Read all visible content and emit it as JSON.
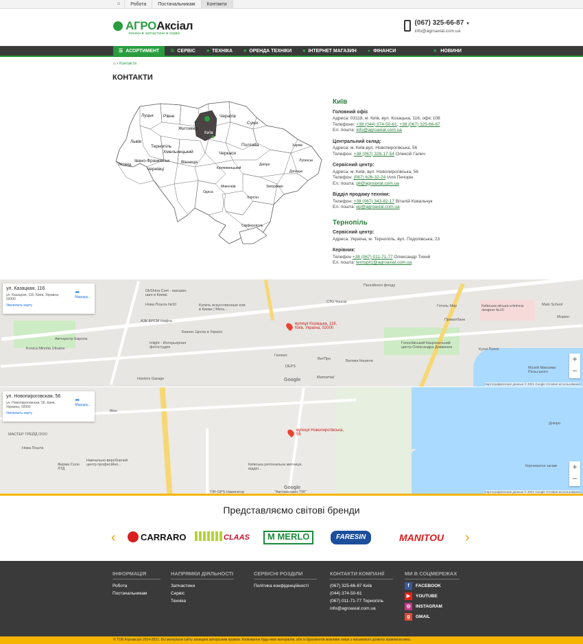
{
  "topbar": {
    "home_icon": "home-icon",
    "links": [
      "Робота",
      "Постачальникам",
      "Контакти"
    ]
  },
  "logo": {
    "part1": "АГРО",
    "part2": "Аксіал",
    "tagline": "техніка ● запчастини ● сервіс"
  },
  "contact_header": {
    "phone": "(067) 325-66-87",
    "email": "info@agroaxial.com.ua",
    "icon": "smartphone-icon"
  },
  "nav": {
    "items": [
      "АСОРТИМЕНТ",
      "СЕРВІС",
      "ТЕХНІКА",
      "ОРЕНДА ТЕХНІКИ",
      "ІНТЕРНЕТ МАГАЗИН",
      "ФІНАНСИ"
    ],
    "right": "НОВИНИ"
  },
  "breadcrumb": {
    "current": "Контакти"
  },
  "page_title": "КОНТАКТИ",
  "map_regions": [
    "Луцьк",
    "Рівне",
    "Житомир",
    "Київ",
    "Чернігів",
    "Суми",
    "Харків",
    "Полтава",
    "Черкаси",
    "Вінниця",
    "Хмельницький",
    "Тернопіль",
    "Львів",
    "Ужгород",
    "Івано-Франківськ",
    "Чернівці",
    "Кропивницький",
    "Дніпро",
    "Луганськ",
    "Донецьк",
    "Запоріжжя",
    "Миколаїв",
    "Одеса",
    "Херсон",
    "Сімферополь"
  ],
  "contacts": {
    "kyiv": {
      "city": "Київ",
      "main": {
        "title": "Головний офіс",
        "address": "Адреса: 03118, м. Київ, вул. Козацька, 116, офіс 108",
        "phones_label": "Телефони:",
        "phone1": "+38 (044) 374-50-61",
        "phone2": "+38 (067) 325-66-87",
        "email_label": "Ел. пошта:",
        "email": "info@agroaxial.com.ua"
      },
      "warehouse": {
        "title": "Центральний склад:",
        "address": "Адреса: м. Київ,вул. Новопирогівська, 56",
        "phone_label": "Телефон:",
        "phone": "+38 (067) 326-17-54",
        "person": "Олексій Галич"
      },
      "service": {
        "title": "Сервісний центр:",
        "address": "Адреса: м. Київ, вул. Новопирогівська, 56",
        "phone_label": "Телефон:",
        "phone": "(067) 626-32-24",
        "person": "Ілля Печорін",
        "email_label": "Ел. пошта:",
        "email": "pil@agroaxial.com.ua"
      },
      "sales": {
        "title": "Відділ продажу техніки:",
        "phone_label": "Телефон:",
        "phone": "+38 (067) 343-82-17",
        "person": "Віталій Ковальчук",
        "email_label": "Ел. пошта:",
        "email": "ep@agroaxial.com.ua"
      }
    },
    "ternopil": {
      "city": "Тернопіль",
      "service": {
        "title": "Сервісний центр:",
        "address": "Адреса: Україна, м. Тернопіль, вул. Подолівська, 23"
      },
      "head": {
        "title": "Керівник:",
        "phone_label": "Телефон",
        "phone": "+38 (067) 011-71-77",
        "person": "Олександр Тихий",
        "email_label": "Ел. пошта:",
        "email": "ternopil1@agroaxial.com.ua"
      }
    }
  },
  "map1": {
    "card_title": "ул. Казацкая, 116",
    "card_addr": "ул. Казацкая, 116, Киев, Украина, 02000",
    "card_link": "Увеличить карту",
    "route": "Маршру...",
    "pin_label": "вулиця Козацька, 116, Київ, Україна, 02000",
    "labels": [
      "OkShina Com - магазин шин в Киеве",
      "Купить искусственные ели в Киеве | Мега...",
      "Нова Пошта №10",
      "АЗК БРСМ Нафта",
      "Бизнес Центр в Україні",
      "Автоцентр Европа",
      "Konica Minolta Ukraine",
      "Inlight - Интерьерная фотостудия",
      "Hunters Garage",
      "Гюнхел",
      "ВетПро",
      "DEPS",
      "Велика Кишеня",
      "Голосіївський Національний центр Олександра Довженка",
      "Готель Мир",
      "Київська міська клінічна лікарня №10",
      "Приватбанк",
      "Main School",
      "Моріон",
      "Кухні Поллі",
      "Музей Максима Рильського",
      "СТО Youcar",
      "Пенсійного фонду",
      "Mamamia!"
    ],
    "footer": "Картографические данные © 2021 Google   Условия использования"
  },
  "map2": {
    "card_title": "ул. Новопироговская, 56",
    "card_addr": "ул. Новопироговская, 56, Киев, Украина, 02000",
    "card_link": "Увеличить карту",
    "route": "Маршру...",
    "pin_label": "вулиця Новопирогівська, 56",
    "labels": [
      "МАСТЕР ТРЕЙД ООО",
      "Нова Пошта",
      "Навчально-виробничий центр професійно...",
      "Фирма Соло ЛТД",
      "Київська регіональна митниця, відділ...",
      "Корчеватое залив",
      "Дніпро",
      "iBox",
      "\"Автомагазин TIR\"",
      "TIR-GPS Навигатор"
    ],
    "footer": "Картографические данные © 2021 Google   Условия использования"
  },
  "brands": {
    "title": "Представляємо світові бренди",
    "items": [
      "CARRARO",
      "CLAAS",
      "MERLO",
      "FARESIN",
      "MANITOU"
    ]
  },
  "footer": {
    "info": {
      "title": "ІНФОРМАЦІЯ",
      "items": [
        "Робота",
        "Постачальникам"
      ]
    },
    "directions": {
      "title": "НАПРЯМКИ ДІЯЛЬНОСТІ",
      "items": [
        "Запчастини",
        "Сервіс",
        "Техніка"
      ]
    },
    "service": {
      "title": "СЕРВІСНІ РОЗДІЛИ",
      "items": [
        "Політика конфіденційності"
      ]
    },
    "contacts": {
      "title": "КОНТАКТИ КОМПАНІЇ",
      "items": [
        "(067) 325-66-87 Київ",
        "(044) 374-50-61",
        "(067) 011-71-77 Тернопіль",
        "info@agroaxial.com.ua"
      ]
    },
    "social": {
      "title": "МИ В СОЦМЕРЕЖАХ",
      "items": [
        "FACEBOOK",
        "YOUTUBE",
        "INSTAGRAM",
        "GMAIL"
      ]
    }
  },
  "copyright": "© ТОВ Агроаксіал 2014-2021. Всі матеріали сайту захищені авторським правом. Копіювання будь-яких матеріалів, або їх фрагментів можливе лише з письмового дозволу правовласника.",
  "colors": {
    "green": "#2a9d3f",
    "dark": "#3a3a3a",
    "yellow": "#f5b400"
  }
}
